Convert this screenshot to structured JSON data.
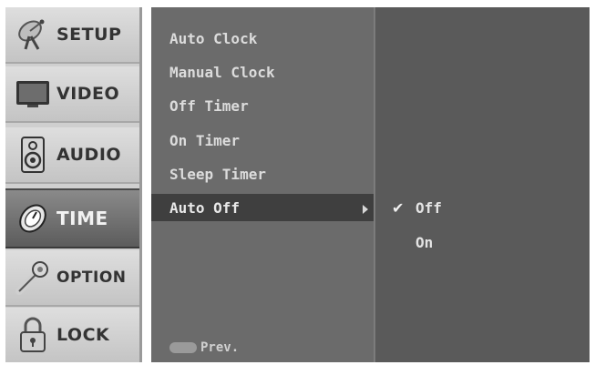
{
  "categories": [
    {
      "label": "SETUP",
      "icon": "satellite-dish-icon"
    },
    {
      "label": "VIDEO",
      "icon": "tv-icon"
    },
    {
      "label": "AUDIO",
      "icon": "speaker-icon"
    },
    {
      "label": "TIME",
      "icon": "clock-icon",
      "active": true
    },
    {
      "label": "OPTION",
      "icon": "wrench-icon"
    },
    {
      "label": "LOCK",
      "icon": "padlock-icon"
    }
  ],
  "menu": {
    "items": [
      "Auto Clock",
      "Manual Clock",
      "Off Timer",
      "On Timer",
      "Sleep Timer",
      "Auto Off"
    ],
    "selected": "Auto Off",
    "footer_key": "MENU",
    "footer_label": "Prev."
  },
  "submenu": {
    "options": [
      "Off",
      "On"
    ],
    "checked": "Off",
    "check_glyph": "✔"
  },
  "colors": {
    "panel": "#5c5c5c",
    "menu": "#6b6b6b",
    "selected_row": "#3f3f3f",
    "active_category": "#5c5c5c"
  }
}
